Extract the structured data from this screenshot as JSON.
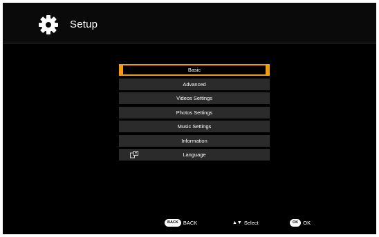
{
  "header": {
    "title": "Setup",
    "icon": "gear-icon"
  },
  "menu": {
    "items": [
      {
        "label": "Basic",
        "selected": true
      },
      {
        "label": "Advanced"
      },
      {
        "label": "Videos Settings"
      },
      {
        "label": "Photos Settings"
      },
      {
        "label": "Music Settings"
      },
      {
        "label": "Information"
      },
      {
        "label": "Language",
        "icon": "language-icon"
      }
    ]
  },
  "footer": {
    "back": {
      "button": "BACK",
      "label": "BACK"
    },
    "select": {
      "arrows": "▲▼",
      "label": "Select"
    },
    "ok": {
      "button": "OK",
      "label": "OK"
    }
  },
  "colors": {
    "accent": "#f39c12",
    "item_bg": "#2b2b2b",
    "background": "#000000"
  }
}
